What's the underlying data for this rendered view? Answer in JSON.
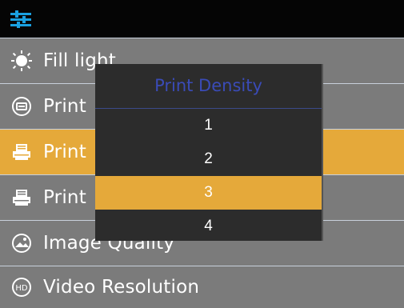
{
  "colors": {
    "accent": "#e5a93a",
    "background": "#7b7b7b",
    "topbar": "#050505",
    "popup": "#2c2c2c",
    "popup_title": "#3a4bb7",
    "icon_blue": "#1aa0e0"
  },
  "header": {
    "icon": "settings-sliders-icon"
  },
  "menu": {
    "items": [
      {
        "icon": "sun-icon",
        "label": "Fill light"
      },
      {
        "icon": "print-icon",
        "label": "Print"
      },
      {
        "icon": "printer-icon",
        "label": "Print",
        "selected": true
      },
      {
        "icon": "printer-icon",
        "label": "Print"
      },
      {
        "icon": "image-quality-icon",
        "label": "Image Quality"
      },
      {
        "icon": "hd-icon",
        "label": "Video Resolution"
      }
    ]
  },
  "popup": {
    "title": "Print Density",
    "options": [
      "1",
      "2",
      "3",
      "4"
    ],
    "selected": "3"
  }
}
